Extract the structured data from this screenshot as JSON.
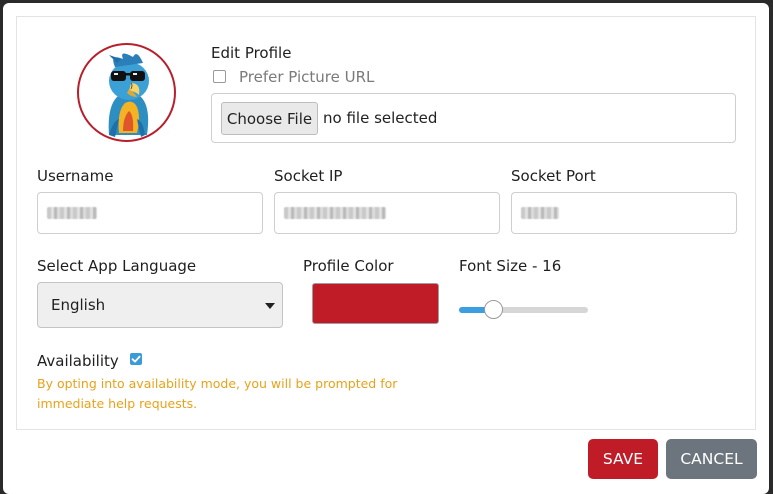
{
  "profile": {
    "title": "Edit Profile",
    "prefer_url_label": "Prefer Picture URL",
    "prefer_url_checked": false,
    "choose_file_label": "Choose File",
    "file_status": "no file selected"
  },
  "fields": {
    "username_label": "Username",
    "socket_ip_label": "Socket IP",
    "socket_port_label": "Socket Port",
    "language_label": "Select App Language",
    "language_value": "English",
    "profile_color_label": "Profile Color",
    "profile_color": "#c01c28",
    "font_size_label": "Font Size - 16",
    "font_size_fraction": 0.26
  },
  "availability": {
    "label": "Availability",
    "checked": true,
    "notice": "By opting into availability mode, you will be prompted for immediate help requests."
  },
  "actions": {
    "save_label": "SAVE",
    "cancel_label": "CANCEL"
  },
  "colors": {
    "accent": "#c01c28",
    "checkbox": "#3b9bd9",
    "notice": "#e8a21a",
    "cancel": "#6c757d"
  },
  "icons": {
    "avatar": "parrot-with-sunglasses",
    "check": "check-icon",
    "caret": "chevron-down-icon"
  }
}
